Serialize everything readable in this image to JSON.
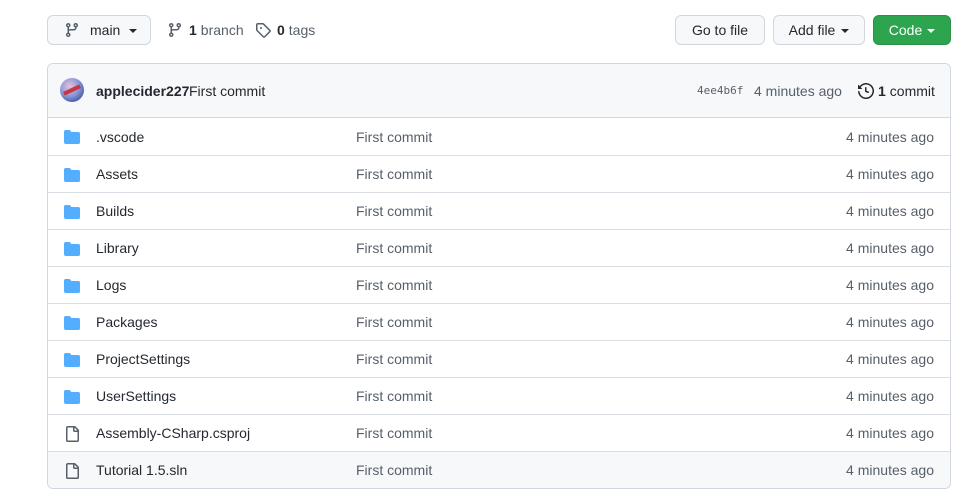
{
  "toolbar": {
    "branch_label": "main",
    "branch_count": "1",
    "branch_word": "branch",
    "tag_count": "0",
    "tag_word": "tags",
    "goto_label": "Go to file",
    "add_label": "Add file",
    "code_label": "Code",
    "code_color": "#2da44e"
  },
  "commit": {
    "author": "applecider227",
    "message": "First commit",
    "sha": "4ee4b6f",
    "time": "4 minutes ago",
    "count": "1",
    "count_word": "commit"
  },
  "files": [
    {
      "name": ".vscode",
      "type": "folder",
      "message": "First commit",
      "time": "4 minutes ago"
    },
    {
      "name": "Assets",
      "type": "folder",
      "message": "First commit",
      "time": "4 minutes ago"
    },
    {
      "name": "Builds",
      "type": "folder",
      "message": "First commit",
      "time": "4 minutes ago"
    },
    {
      "name": "Library",
      "type": "folder",
      "message": "First commit",
      "time": "4 minutes ago"
    },
    {
      "name": "Logs",
      "type": "folder",
      "message": "First commit",
      "time": "4 minutes ago"
    },
    {
      "name": "Packages",
      "type": "folder",
      "message": "First commit",
      "time": "4 minutes ago"
    },
    {
      "name": "ProjectSettings",
      "type": "folder",
      "message": "First commit",
      "time": "4 minutes ago"
    },
    {
      "name": "UserSettings",
      "type": "folder",
      "message": "First commit",
      "time": "4 minutes ago"
    },
    {
      "name": "Assembly-CSharp.csproj",
      "type": "file",
      "message": "First commit",
      "time": "4 minutes ago"
    },
    {
      "name": "Tutorial 1.5.sln",
      "type": "file",
      "message": "First commit",
      "time": "4 minutes ago"
    }
  ],
  "icons": {
    "folder": "folder-icon",
    "file": "file-icon",
    "branch": "git-branch-icon",
    "tag": "tag-icon",
    "history": "history-icon"
  },
  "colors": {
    "folder": "#54aeff",
    "file_icon": "#57606a",
    "muted_text": "#57606a"
  }
}
